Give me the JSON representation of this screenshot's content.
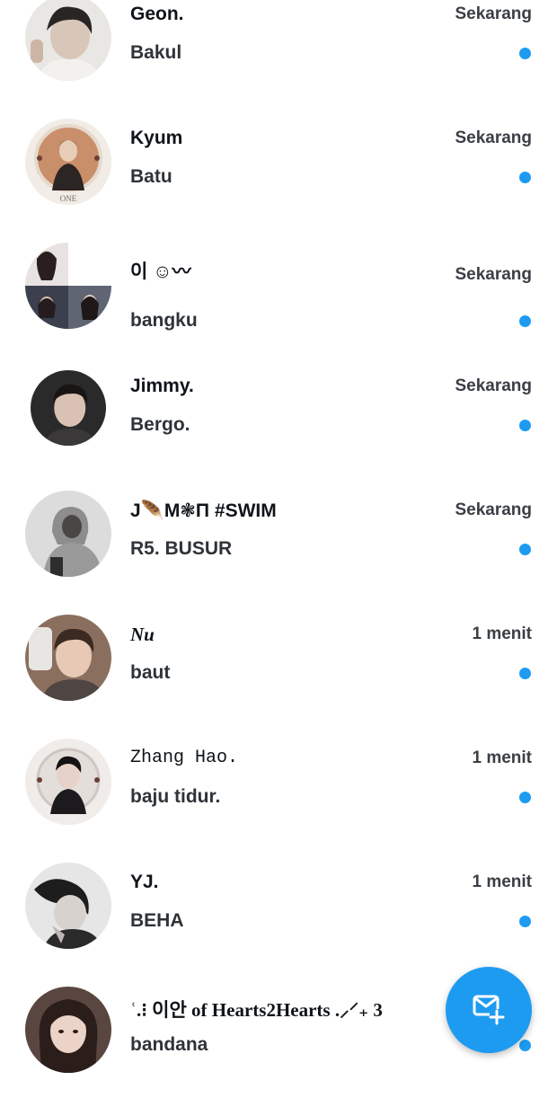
{
  "conversations": [
    {
      "name": "Geon.",
      "time": "Sekarang",
      "message": "Bakul",
      "unread": true
    },
    {
      "name": "Kyum",
      "time": "Sekarang",
      "message": "Batu",
      "unread": true
    },
    {
      "name": "이 ☺︎〰",
      "time": "Sekarang",
      "message": "bangku",
      "unread": true
    },
    {
      "name": "Jimmy.",
      "time": "Sekarang",
      "message": "Bergo.",
      "unread": true
    },
    {
      "name": "J🪶M❃Π #SWIM",
      "time": "Sekarang",
      "message": "R5. BUSUR",
      "unread": true
    },
    {
      "name": "Nu",
      "time": "1 menit",
      "message": "baut",
      "unread": true
    },
    {
      "name": "Zhang Hao.",
      "time": "1 menit",
      "message": "baju tidur.",
      "unread": true
    },
    {
      "name": "YJ.",
      "time": "1 menit",
      "message": "BEHA",
      "unread": true
    },
    {
      "name": "ʿ.⁝ 이안 of Hearts2Hearts .⸝⸍₊ 3",
      "time": "",
      "message": "bandana",
      "unread": true
    }
  ],
  "fab": {
    "icon": "new-message-icon"
  },
  "colors": {
    "accent": "#1d9bf0",
    "text": "#0f1419",
    "muted": "#3a3f45"
  }
}
